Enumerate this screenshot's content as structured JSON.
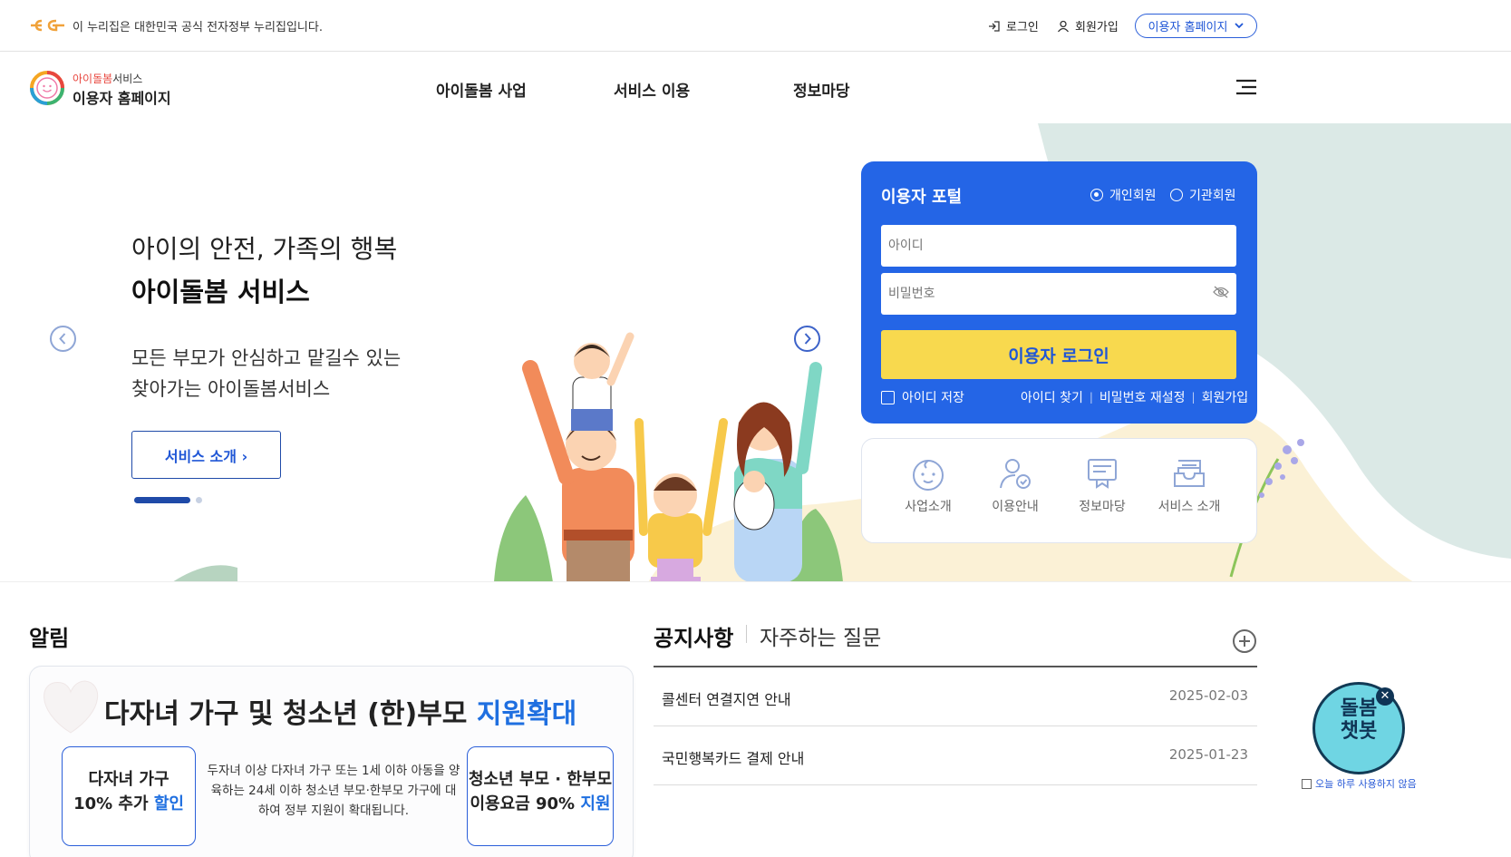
{
  "govbar": {
    "text": "이 누리집은 대한민국 공식 전자정부 누리집입니다.",
    "login": "로그인",
    "signup": "회원가입",
    "site_select": "이용자 홈페이지"
  },
  "header": {
    "logo_line1_accent": "아이돌봄",
    "logo_line1_rest": "서비스",
    "logo_line2": "이용자 홈페이지",
    "nav": [
      "아이돌봄 사업",
      "서비스 이용",
      "정보마당"
    ]
  },
  "hero": {
    "tagline": "아이의 안전, 가족의 행복",
    "title": "아이돌봄 서비스",
    "desc1": "모든 부모가 안심하고 맡길수 있는",
    "desc2": "찾아가는 아이돌봄서비스",
    "button": "서비스 소개 ›"
  },
  "login": {
    "title": "이용자 포털",
    "radio_personal": "개인회원",
    "radio_org": "기관회원",
    "id_placeholder": "아이디",
    "pw_placeholder": "비밀번호",
    "button": "이용자 로그인",
    "save_id": "아이디 저장",
    "find_id": "아이디 찾기",
    "reset_pw": "비밀번호 재설정",
    "signup": "회원가입"
  },
  "quick_menu": [
    {
      "label": "사업소개",
      "icon": "baby-face-icon"
    },
    {
      "label": "이용안내",
      "icon": "user-check-icon"
    },
    {
      "label": "정보마당",
      "icon": "board-icon"
    },
    {
      "label": "서비스 소개",
      "icon": "inbox-icon"
    }
  ],
  "notice": {
    "heading": "알림",
    "banner_title_main": "다자녀 가구 및 청소년 (한)부모 ",
    "banner_title_hl": "지원확대",
    "card_left_line1": "다자녀 가구",
    "card_left_line2": "10% 추가 ",
    "card_left_hl": "할인",
    "card_right_line1": "청소년 부모 · 한부모",
    "card_right_line2": "이용요금 90% ",
    "card_right_hl": "지원",
    "desc": "두자녀 이상 다자녀 가구 또는 1세 이하 아동을 양육하는 24세 이하 청소년 부모·한부모 가구에 대하여 정부 지원이 확대됩니다."
  },
  "board": {
    "tab_notice": "공지사항",
    "tab_faq": "자주하는 질문",
    "items": [
      {
        "title": "콜센터 연결지연 안내",
        "date": "2025-02-03"
      },
      {
        "title": "국민행복카드 결제 안내",
        "date": "2025-01-23"
      }
    ]
  },
  "chatbot": {
    "line1": "돌봄",
    "line2": "챗봇",
    "hide_today": "오늘 하루 사용하지 않음"
  },
  "colors": {
    "primary": "#2465e6",
    "login_button": "#f8d94e",
    "accent_text": "#1f56d6"
  }
}
